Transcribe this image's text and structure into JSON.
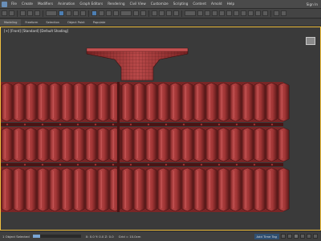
{
  "menubar": {
    "items": [
      "File",
      "Create",
      "Modifiers",
      "Animation",
      "Graph Editors",
      "Rendering",
      "Civil View",
      "Customize",
      "Scripting",
      "Content",
      "Arnold",
      "Help"
    ],
    "sign_in": "Sign In"
  },
  "toolbar": {
    "selection_filter": "All",
    "view_dropdown": "View"
  },
  "ribbon": {
    "tabs": [
      "Modeling",
      "Freeform",
      "Selection",
      "Object Paint",
      "Populate"
    ],
    "selected": "Modeling"
  },
  "viewport": {
    "label": "[+] [Front] [Standard] [Default Shading]",
    "border_color": "#f0c040",
    "model_color": "#a53a3a"
  },
  "status": {
    "message": "1 Object Selected",
    "progress": 0.15,
    "coords": "X: 0.0   Y: 0.0   Z: 0.0",
    "grid": "Grid = 10.0cm",
    "add_time_tag": "Add Time Tag"
  }
}
